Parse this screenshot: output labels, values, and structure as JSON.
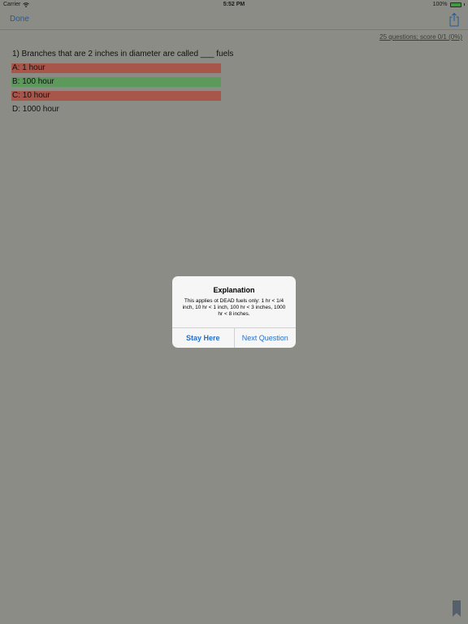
{
  "status_bar": {
    "carrier": "Carrier",
    "time": "5:52 PM",
    "battery": "100%",
    "battery_level": 1.0
  },
  "nav": {
    "done_label": "Done",
    "share_icon": "share-icon"
  },
  "score_text": "25 questions; score 0/1 (0%)",
  "question": "1) Branches that are 2 inches in diameter are called ___ fuels",
  "answers": [
    {
      "label": "A: 1 hour",
      "state": "wrong"
    },
    {
      "label": "B: 100 hour",
      "state": "correct"
    },
    {
      "label": "C: 10 hour",
      "state": "wrong"
    },
    {
      "label": "D: 1000 hour",
      "state": "none"
    }
  ],
  "alert": {
    "title": "Explanation",
    "message": "This applies ot DEAD fuels only: 1 hr < 1/4 inch, 10 hr < 1 inch, 100 hr < 3 inches, 1000 hr < 8 inches.",
    "stay_label": "Stay Here",
    "next_label": "Next Question"
  },
  "colors": {
    "wrong": "#a8554a",
    "correct": "#5c9a5c",
    "accent": "#1f6fd1",
    "dim_background": "#8c8c86"
  },
  "bookmark_icon": "bookmark-icon"
}
